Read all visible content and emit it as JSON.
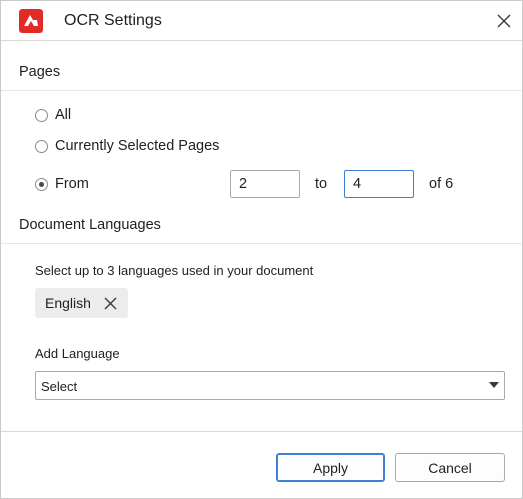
{
  "window": {
    "title": "OCR Settings",
    "logo_icon": "app-logo-icon",
    "close_icon": "close-icon",
    "logo_color": "#e02b27"
  },
  "pages_section": {
    "header": "Pages",
    "options": [
      {
        "label": "All",
        "checked": false
      },
      {
        "label": "Currently Selected Pages",
        "checked": false
      },
      {
        "label": "From",
        "checked": true
      }
    ],
    "from_value": "2",
    "to_label": "to",
    "to_value": "4",
    "of_label": "of 6"
  },
  "languages_section": {
    "header": "Document Languages",
    "hint": "Select up to 3 languages used in your document",
    "selected": [
      {
        "label": "English",
        "remove_icon": "close-icon"
      }
    ],
    "add_label": "Add Language",
    "select_value": "Select",
    "select_icon": "dropdown-arrow-icon"
  },
  "footer": {
    "apply_label": "Apply",
    "cancel_label": "Cancel",
    "accent_color": "#3c7fd4"
  }
}
